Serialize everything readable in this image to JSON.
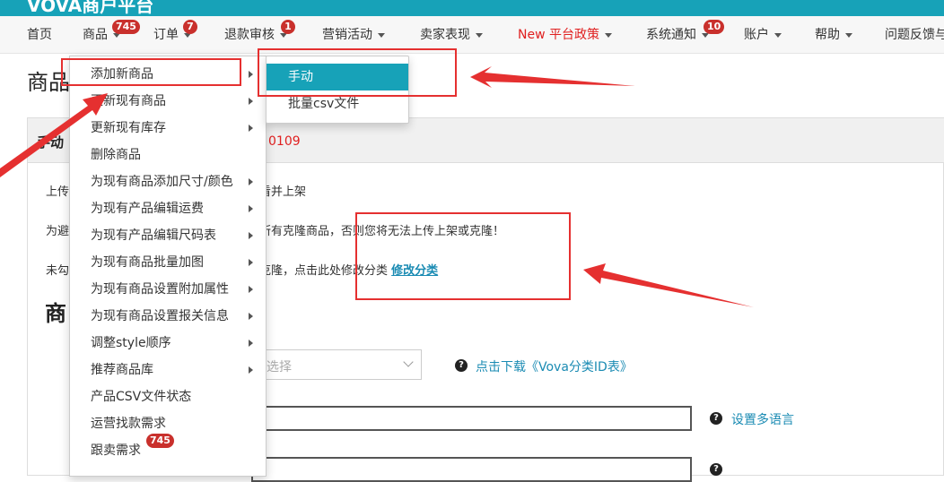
{
  "brand": "VOVA商户平台",
  "nav": {
    "items": [
      {
        "label": "首页",
        "caret": false,
        "badge": ""
      },
      {
        "label": "商品",
        "caret": true,
        "badge": "745"
      },
      {
        "label": "订单",
        "caret": true,
        "badge": "7"
      },
      {
        "label": "退款审核",
        "caret": true,
        "badge": "1"
      },
      {
        "label": "营销活动",
        "caret": true,
        "badge": ""
      },
      {
        "label": "卖家表现",
        "caret": true,
        "badge": ""
      },
      {
        "label": "New 平台政策",
        "caret": true,
        "badge": ""
      },
      {
        "label": "系统通知",
        "caret": true,
        "badge": "10"
      },
      {
        "label": "账户",
        "caret": true,
        "badge": ""
      },
      {
        "label": "帮助",
        "caret": true,
        "badge": ""
      },
      {
        "label": "问题反馈与",
        "caret": false,
        "badge": ""
      }
    ]
  },
  "page": {
    "title": "商品",
    "panel_title": "手动",
    "panel_number": "0109",
    "line1": "看并上架",
    "line2": "所有克隆商品，否则您将无法上传上架或克隆！",
    "line3_text": "克隆，点击此处修改分类 ",
    "line3_link": "修改分类",
    "line1_prefix": "上传",
    "line2_prefix": "为避",
    "line3_prefix": "未勾",
    "section_title": "商",
    "select_placeholder": "选择",
    "download_link": "点击下载《Vova分类ID表》",
    "multi_lang_link": "设置多语言",
    "help_icon": "?"
  },
  "menu": {
    "items": [
      {
        "label": "添加新商品",
        "arrow": true
      },
      {
        "label": "更新现有商品",
        "arrow": true
      },
      {
        "label": "更新现有库存",
        "arrow": true
      },
      {
        "label": "删除商品",
        "arrow": false
      },
      {
        "label": "为现有商品添加尺寸/颜色",
        "arrow": true
      },
      {
        "label": "为现有产品编辑运费",
        "arrow": true
      },
      {
        "label": "为现有产品编辑尺码表",
        "arrow": true
      },
      {
        "label": "为现有商品批量加图",
        "arrow": true
      },
      {
        "label": "为现有商品设置附加属性",
        "arrow": true
      },
      {
        "label": "为现有商品设置报关信息",
        "arrow": true
      },
      {
        "label": "调整style顺序",
        "arrow": true
      },
      {
        "label": "推荐商品库",
        "arrow": true
      },
      {
        "label": "产品CSV文件状态",
        "arrow": false
      },
      {
        "label": "运营找款需求",
        "arrow": false
      },
      {
        "label": "跟卖需求",
        "arrow": false,
        "badge": "745"
      }
    ]
  },
  "submenu": {
    "items": [
      {
        "label": "手动"
      },
      {
        "label": "批量csv文件"
      }
    ]
  },
  "colors": {
    "accent": "#17a2b8",
    "badge": "#c9302c",
    "annotation": "#e53030",
    "link": "#1a8bb3"
  }
}
